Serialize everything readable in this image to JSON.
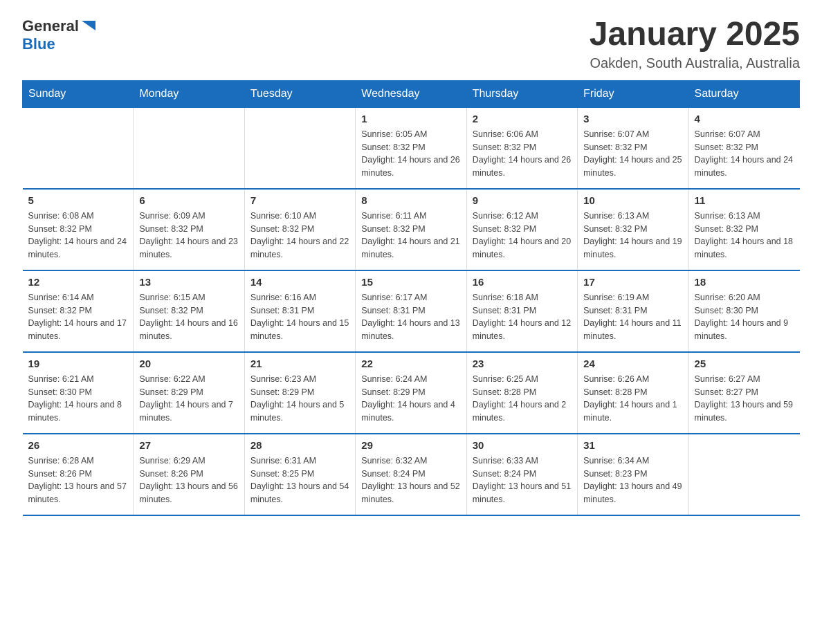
{
  "logo": {
    "text_general": "General",
    "text_blue": "Blue",
    "aria": "GeneralBlue logo"
  },
  "header": {
    "title": "January 2025",
    "subtitle": "Oakden, South Australia, Australia"
  },
  "weekdays": [
    "Sunday",
    "Monday",
    "Tuesday",
    "Wednesday",
    "Thursday",
    "Friday",
    "Saturday"
  ],
  "weeks": [
    [
      {
        "day": "",
        "info": ""
      },
      {
        "day": "",
        "info": ""
      },
      {
        "day": "",
        "info": ""
      },
      {
        "day": "1",
        "info": "Sunrise: 6:05 AM\nSunset: 8:32 PM\nDaylight: 14 hours and 26 minutes."
      },
      {
        "day": "2",
        "info": "Sunrise: 6:06 AM\nSunset: 8:32 PM\nDaylight: 14 hours and 26 minutes."
      },
      {
        "day": "3",
        "info": "Sunrise: 6:07 AM\nSunset: 8:32 PM\nDaylight: 14 hours and 25 minutes."
      },
      {
        "day": "4",
        "info": "Sunrise: 6:07 AM\nSunset: 8:32 PM\nDaylight: 14 hours and 24 minutes."
      }
    ],
    [
      {
        "day": "5",
        "info": "Sunrise: 6:08 AM\nSunset: 8:32 PM\nDaylight: 14 hours and 24 minutes."
      },
      {
        "day": "6",
        "info": "Sunrise: 6:09 AM\nSunset: 8:32 PM\nDaylight: 14 hours and 23 minutes."
      },
      {
        "day": "7",
        "info": "Sunrise: 6:10 AM\nSunset: 8:32 PM\nDaylight: 14 hours and 22 minutes."
      },
      {
        "day": "8",
        "info": "Sunrise: 6:11 AM\nSunset: 8:32 PM\nDaylight: 14 hours and 21 minutes."
      },
      {
        "day": "9",
        "info": "Sunrise: 6:12 AM\nSunset: 8:32 PM\nDaylight: 14 hours and 20 minutes."
      },
      {
        "day": "10",
        "info": "Sunrise: 6:13 AM\nSunset: 8:32 PM\nDaylight: 14 hours and 19 minutes."
      },
      {
        "day": "11",
        "info": "Sunrise: 6:13 AM\nSunset: 8:32 PM\nDaylight: 14 hours and 18 minutes."
      }
    ],
    [
      {
        "day": "12",
        "info": "Sunrise: 6:14 AM\nSunset: 8:32 PM\nDaylight: 14 hours and 17 minutes."
      },
      {
        "day": "13",
        "info": "Sunrise: 6:15 AM\nSunset: 8:32 PM\nDaylight: 14 hours and 16 minutes."
      },
      {
        "day": "14",
        "info": "Sunrise: 6:16 AM\nSunset: 8:31 PM\nDaylight: 14 hours and 15 minutes."
      },
      {
        "day": "15",
        "info": "Sunrise: 6:17 AM\nSunset: 8:31 PM\nDaylight: 14 hours and 13 minutes."
      },
      {
        "day": "16",
        "info": "Sunrise: 6:18 AM\nSunset: 8:31 PM\nDaylight: 14 hours and 12 minutes."
      },
      {
        "day": "17",
        "info": "Sunrise: 6:19 AM\nSunset: 8:31 PM\nDaylight: 14 hours and 11 minutes."
      },
      {
        "day": "18",
        "info": "Sunrise: 6:20 AM\nSunset: 8:30 PM\nDaylight: 14 hours and 9 minutes."
      }
    ],
    [
      {
        "day": "19",
        "info": "Sunrise: 6:21 AM\nSunset: 8:30 PM\nDaylight: 14 hours and 8 minutes."
      },
      {
        "day": "20",
        "info": "Sunrise: 6:22 AM\nSunset: 8:29 PM\nDaylight: 14 hours and 7 minutes."
      },
      {
        "day": "21",
        "info": "Sunrise: 6:23 AM\nSunset: 8:29 PM\nDaylight: 14 hours and 5 minutes."
      },
      {
        "day": "22",
        "info": "Sunrise: 6:24 AM\nSunset: 8:29 PM\nDaylight: 14 hours and 4 minutes."
      },
      {
        "day": "23",
        "info": "Sunrise: 6:25 AM\nSunset: 8:28 PM\nDaylight: 14 hours and 2 minutes."
      },
      {
        "day": "24",
        "info": "Sunrise: 6:26 AM\nSunset: 8:28 PM\nDaylight: 14 hours and 1 minute."
      },
      {
        "day": "25",
        "info": "Sunrise: 6:27 AM\nSunset: 8:27 PM\nDaylight: 13 hours and 59 minutes."
      }
    ],
    [
      {
        "day": "26",
        "info": "Sunrise: 6:28 AM\nSunset: 8:26 PM\nDaylight: 13 hours and 57 minutes."
      },
      {
        "day": "27",
        "info": "Sunrise: 6:29 AM\nSunset: 8:26 PM\nDaylight: 13 hours and 56 minutes."
      },
      {
        "day": "28",
        "info": "Sunrise: 6:31 AM\nSunset: 8:25 PM\nDaylight: 13 hours and 54 minutes."
      },
      {
        "day": "29",
        "info": "Sunrise: 6:32 AM\nSunset: 8:24 PM\nDaylight: 13 hours and 52 minutes."
      },
      {
        "day": "30",
        "info": "Sunrise: 6:33 AM\nSunset: 8:24 PM\nDaylight: 13 hours and 51 minutes."
      },
      {
        "day": "31",
        "info": "Sunrise: 6:34 AM\nSunset: 8:23 PM\nDaylight: 13 hours and 49 minutes."
      },
      {
        "day": "",
        "info": ""
      }
    ]
  ]
}
